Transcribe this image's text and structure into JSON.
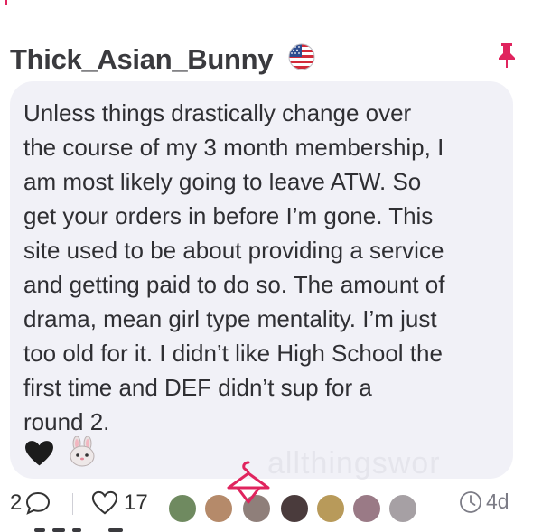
{
  "post": {
    "username": "Thick_Asian_Bunny",
    "flag_icon": "us-flag-icon",
    "pin_icon": "pin-icon",
    "body": "Unless things drastically change over\nthe course of my 3 month membership, I\nam most likely going to leave ATW. So\nget your orders in before I’m gone. This\nsite used to be about providing a service\nand getting paid to do so. The amount of\ndrama, mean girl type mentality. I’m just\ntoo old for it. I didn’t like High School the\nfirst time and DEF didn’t sup for a\nround 2.",
    "emojis": [
      "black-heart-icon",
      "rabbit-face-icon"
    ]
  },
  "watermark": "allthingswor",
  "footer": {
    "comment_count": "2",
    "like_count": "17",
    "time_ago": "4d"
  },
  "colors": {
    "card_bg": "#f1f1f7",
    "pin": "#e0245e",
    "hanger": "#e0245e",
    "text": "#2f2f33",
    "muted": "#7c7c86"
  },
  "avatars": [
    {
      "name": "avatar-1",
      "bg": "#6f8a60"
    },
    {
      "name": "avatar-2",
      "bg": "#b58a6a"
    },
    {
      "name": "avatar-3",
      "bg": "#8f7f7a"
    },
    {
      "name": "avatar-4",
      "bg": "#4a3b3c"
    },
    {
      "name": "avatar-5",
      "bg": "#b89a5a"
    },
    {
      "name": "avatar-6",
      "bg": "#9a7a86"
    },
    {
      "name": "avatar-7",
      "bg": "#a6a0a4"
    }
  ]
}
